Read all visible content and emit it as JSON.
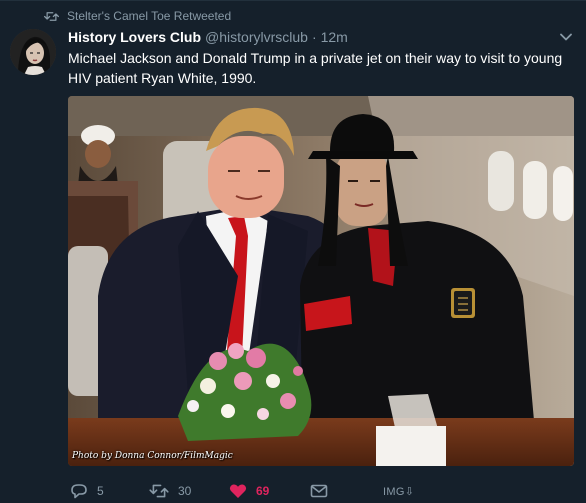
{
  "retweet_context": {
    "icon": "retweet-icon",
    "text": "Stelter's Camel Toe Retweeted"
  },
  "author": {
    "display_name": "History Lovers Club",
    "handle": "@historylvrsclub",
    "separator": "·",
    "time": "12m"
  },
  "tweet": {
    "text": "Michael Jackson and Donald Trump in a private jet on their way to visit to young HIV patient Ryan White, 1990."
  },
  "media": {
    "watermark": "Photo by Donna Connor/FilmMagic"
  },
  "actions": {
    "reply_count": "5",
    "retweet_count": "30",
    "like_count": "69",
    "img_label": "IMG"
  },
  "colors": {
    "background": "#15202b",
    "secondary_text": "#8899a6",
    "like": "#e0245e"
  }
}
